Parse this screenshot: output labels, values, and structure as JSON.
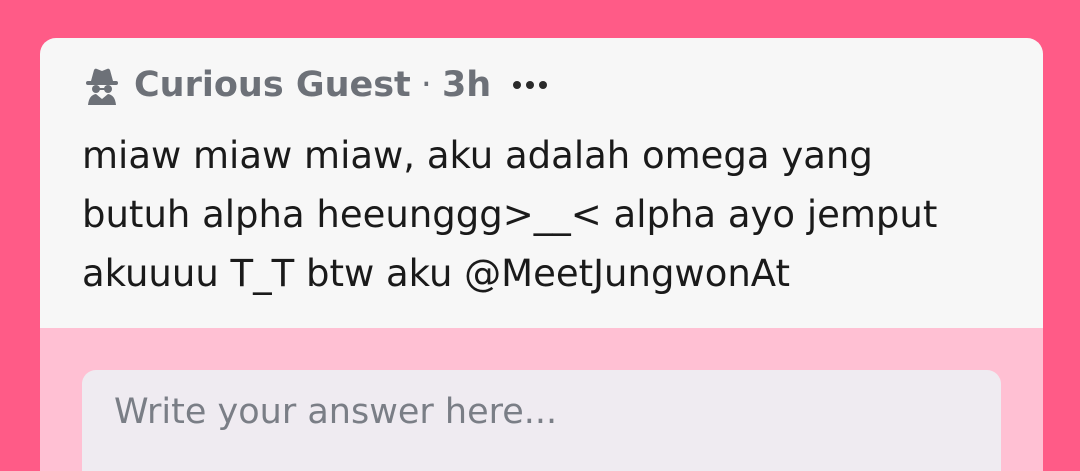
{
  "post": {
    "author": "Curious Guest",
    "separator": "·",
    "time": "3h",
    "question": "miaw miaw miaw, aku adalah omega yang\nbutuh alpha heeunggg>__< alpha ayo jemput\nakuuuu T_T btw aku @MeetJungwonAt"
  },
  "answer": {
    "placeholder": "Write your answer here..."
  },
  "icons": {
    "author_icon": "incognito-spy-icon",
    "more_icon": "more-options-icon"
  },
  "colors": {
    "background": "#ff5b87",
    "card": "#f7f7f7",
    "answer_area": "#ffc0d3",
    "input": "#efebf1",
    "meta_text": "#6d7178"
  }
}
